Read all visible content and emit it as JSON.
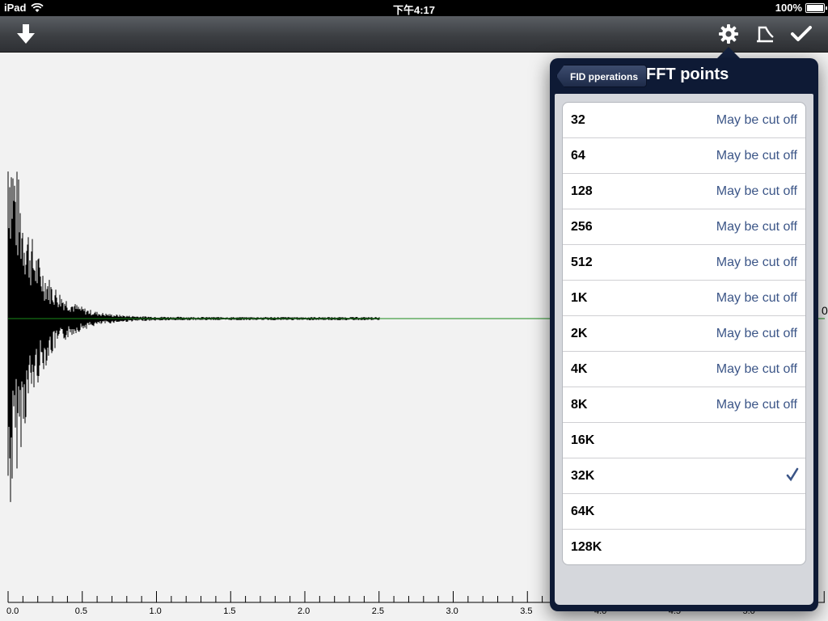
{
  "status_bar": {
    "device": "iPad",
    "time": "下午4:17",
    "battery": "100%"
  },
  "toolbar": {
    "left_icon": "download-arrow-icon",
    "right_icons": [
      "gear-icon",
      "phase-correction-icon",
      "checkmark-icon"
    ]
  },
  "chart_data": {
    "type": "line",
    "x_tick_labels": [
      "0.0",
      "0.5",
      "1.0",
      "1.5",
      "2.0",
      "2.5",
      "3.0",
      "3.5",
      "4.0",
      "4.5",
      "5.0"
    ],
    "xlim": [
      0.0,
      5.3
    ],
    "baseline_color": "#1a8a1a",
    "signal_color": "#000000",
    "right_edge_label": "0"
  },
  "popover": {
    "back_label": "FID pperations",
    "title": "FFT points",
    "items": [
      {
        "label": "32",
        "note": "May be cut off",
        "checked": false
      },
      {
        "label": "64",
        "note": "May be cut off",
        "checked": false
      },
      {
        "label": "128",
        "note": "May be cut off",
        "checked": false
      },
      {
        "label": "256",
        "note": "May be cut off",
        "checked": false
      },
      {
        "label": "512",
        "note": "May be cut off",
        "checked": false
      },
      {
        "label": "1K",
        "note": "May be cut off",
        "checked": false
      },
      {
        "label": "2K",
        "note": "May be cut off",
        "checked": false
      },
      {
        "label": "4K",
        "note": "May be cut off",
        "checked": false
      },
      {
        "label": "8K",
        "note": "May be cut off",
        "checked": false
      },
      {
        "label": "16K",
        "note": "",
        "checked": false
      },
      {
        "label": "32K",
        "note": "",
        "checked": true
      },
      {
        "label": "64K",
        "note": "",
        "checked": false
      },
      {
        "label": "128K",
        "note": "",
        "checked": false
      }
    ]
  }
}
